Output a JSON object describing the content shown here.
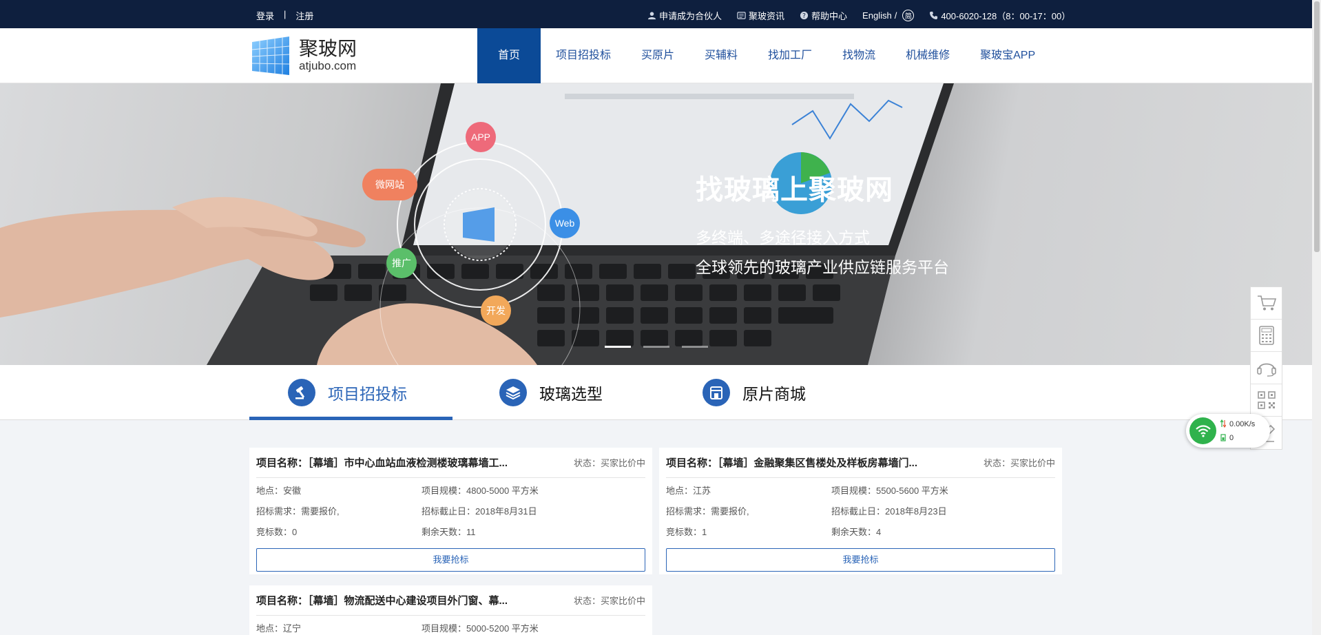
{
  "topbar": {
    "login": "登录",
    "separator": "|",
    "register": "注册",
    "partner": "申请成为合伙人",
    "news": "聚玻资讯",
    "help": "帮助中心",
    "lang": "English",
    "lang_sep": "/",
    "lang_alt": "简",
    "phone": "400-6020-128（8：00-17：00）"
  },
  "logo": {
    "name": "聚玻网",
    "domain": "atjubo.com"
  },
  "nav": {
    "items": [
      {
        "label": "首页"
      },
      {
        "label": "项目招投标"
      },
      {
        "label": "买原片"
      },
      {
        "label": "买辅料"
      },
      {
        "label": "找加工厂"
      },
      {
        "label": "找物流"
      },
      {
        "label": "机械维修"
      },
      {
        "label": "聚玻宝APP"
      }
    ]
  },
  "banner": {
    "headline": "找玻璃上聚玻网",
    "line1": "多终端、多途径接入方式",
    "line2": "全球领先的玻璃产业供应链服务平台",
    "bubbles": {
      "app": "APP",
      "wechat": "微网站",
      "web": "Web",
      "promo": "推广",
      "dev": "开发"
    }
  },
  "tabs": [
    {
      "label": "项目招投标"
    },
    {
      "label": "玻璃选型"
    },
    {
      "label": "原片商城"
    }
  ],
  "cards": [
    {
      "title": "项目名称：［幕墙］市中心血站血液检测楼玻璃幕墙工...",
      "status": "状态：买家比价中",
      "location": "地点：安徽",
      "scale": "项目规模：4800-5000 平方米",
      "demand": "招标需求：需要报价,",
      "deadline": "招标截止日：2018年8月31日",
      "bids": "竞标数：0",
      "remaining": "剩余天数：11",
      "button": "我要抢标"
    },
    {
      "title": "项目名称：［幕墙］金融聚集区售楼处及样板房幕墙门...",
      "status": "状态：买家比价中",
      "location": "地点：江苏",
      "scale": "项目规模：5500-5600 平方米",
      "demand": "招标需求：需要报价,",
      "deadline": "招标截止日：2018年8月23日",
      "bids": "竞标数：1",
      "remaining": "剩余天数：4",
      "button": "我要抢标"
    },
    {
      "title": "项目名称：［幕墙］物流配送中心建设项目外门窗、幕...",
      "status": "状态：买家比价中",
      "location": "地点：辽宁",
      "scale": "项目规模：5000-5200 平方米"
    }
  ],
  "network": {
    "up": "0.00K/s",
    "down": "0"
  },
  "colors": {
    "topbar": "#0e1f3e",
    "accent": "#2a64b7",
    "nav_active": "#0b4a97"
  }
}
